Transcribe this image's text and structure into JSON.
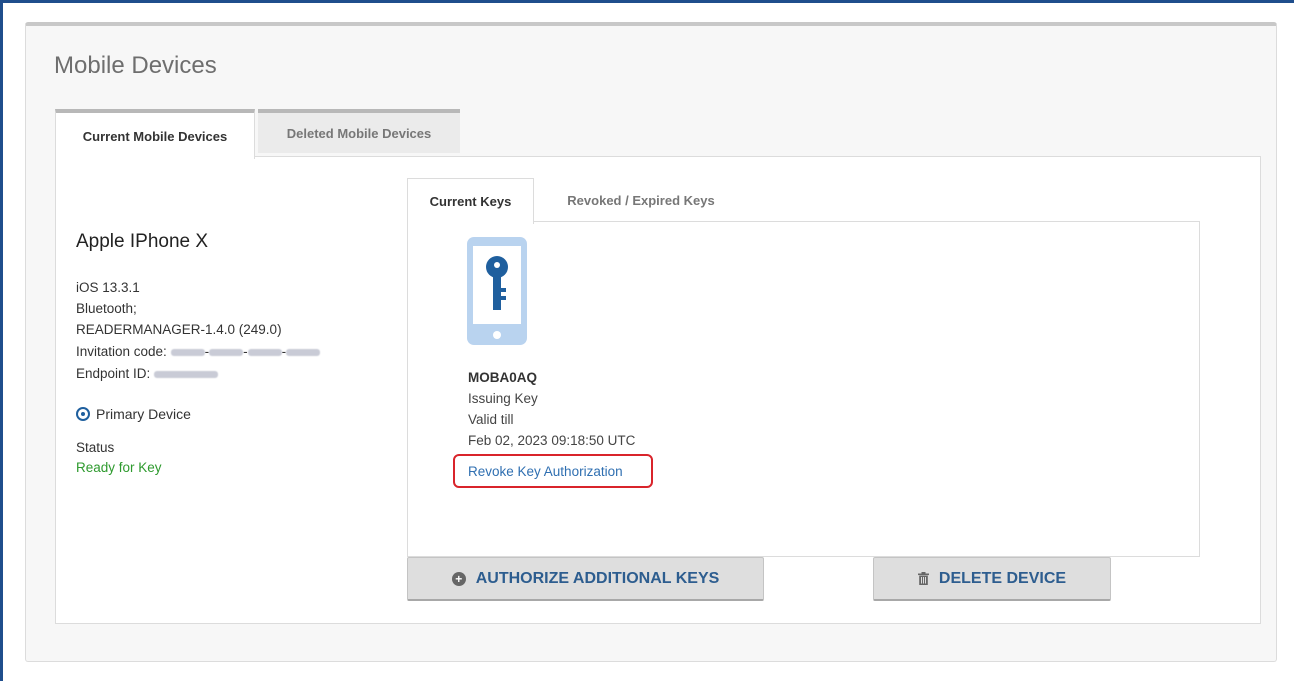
{
  "page": {
    "title": "Mobile Devices"
  },
  "tabs": {
    "current": "Current Mobile Devices",
    "deleted": "Deleted Mobile Devices"
  },
  "device": {
    "name": "Apple IPhone X",
    "os": "iOS 13.3.1",
    "connection": "Bluetooth;",
    "app_version": "READERMANAGER-1.4.0 (249.0)",
    "invitation_label": "Invitation code:",
    "endpoint_label": "Endpoint ID:",
    "primary_label": "Primary Device",
    "status_label": "Status",
    "status_value": "Ready for Key"
  },
  "key_tabs": {
    "current": "Current Keys",
    "revoked": "Revoked / Expired Keys"
  },
  "key": {
    "id": "MOBA0AQ",
    "state": "Issuing Key",
    "valid_label": "Valid till",
    "valid_date": "Feb 02, 2023 09:18:50 UTC",
    "revoke_link": "Revoke Key Authorization"
  },
  "buttons": {
    "authorize": "AUTHORIZE ADDITIONAL KEYS",
    "delete": "DELETE DEVICE"
  },
  "colors": {
    "frame": "#1f4e8c",
    "link": "#2f6fb1",
    "status_green": "#2e9a2e",
    "highlight_red": "#d9242b",
    "key_icon": "#1f5f9e"
  }
}
